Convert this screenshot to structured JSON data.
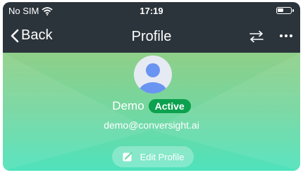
{
  "status_bar": {
    "carrier": "No SIM",
    "time": "17:19",
    "icons": [
      "wifi-icon",
      "battery-icon"
    ]
  },
  "nav": {
    "back_label": "Back",
    "title": "Profile",
    "icons": [
      "chevron-left-icon",
      "switch-arrows-icon",
      "more-icon"
    ]
  },
  "profile": {
    "name": "Demo",
    "status": "Active",
    "email": "demo@conversight.ai",
    "edit_label": "Edit Profile",
    "icons": [
      "avatar-icon",
      "edit-icon"
    ]
  },
  "colors": {
    "topbar": "#2b343b",
    "gradient_top": "#8fcf88",
    "gradient_bottom": "#4fe2bc",
    "badge": "#0ca14f"
  }
}
